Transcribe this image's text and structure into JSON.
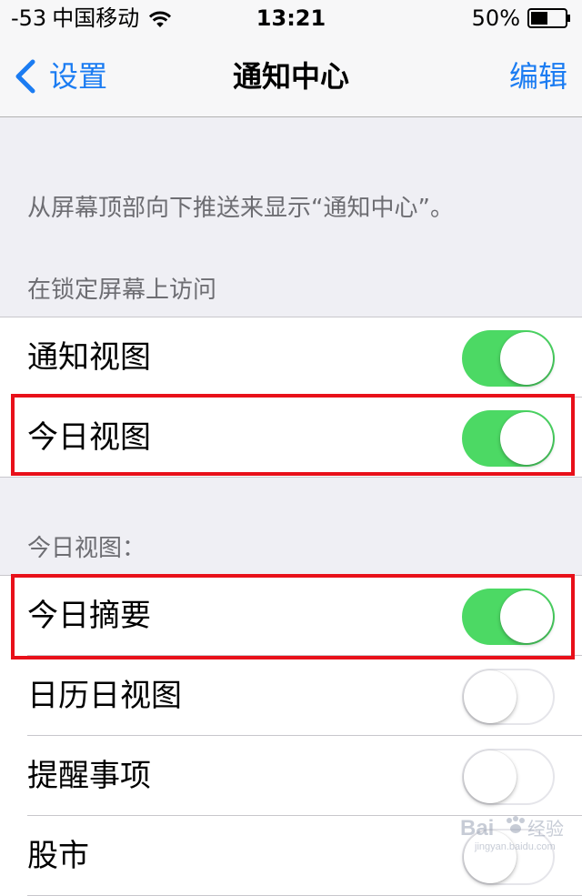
{
  "status_bar": {
    "signal": "-53",
    "carrier": "中国移动",
    "time": "13:21",
    "battery_percent": "50%",
    "battery_level": 0.5,
    "wifi_icon": "wifi-icon",
    "battery_icon": "battery-icon"
  },
  "nav": {
    "back_label": "设置",
    "back_icon": "chevron-left-icon",
    "title": "通知中心",
    "edit_label": "编辑"
  },
  "description": "从屏幕顶部向下推送来显示“通知中心”。",
  "lock_screen_section": {
    "header": "在锁定屏幕上访问",
    "rows": [
      {
        "label": "通知视图",
        "on": true
      },
      {
        "label": "今日视图",
        "on": true
      }
    ]
  },
  "today_section": {
    "header": "今日视图：",
    "rows": [
      {
        "label": "今日摘要",
        "on": true
      },
      {
        "label": "日历日视图",
        "on": false
      },
      {
        "label": "提醒事项",
        "on": false
      },
      {
        "label": "股市",
        "on": false
      }
    ]
  },
  "watermark": {
    "brand": "Bai",
    "brand_suffix": "经验",
    "url": "jingyan.baidu.com"
  },
  "colors": {
    "accent": "#1b7cf2",
    "toggle_on": "#4cd964",
    "highlight": "#e8101a",
    "background": "#efeff4"
  }
}
